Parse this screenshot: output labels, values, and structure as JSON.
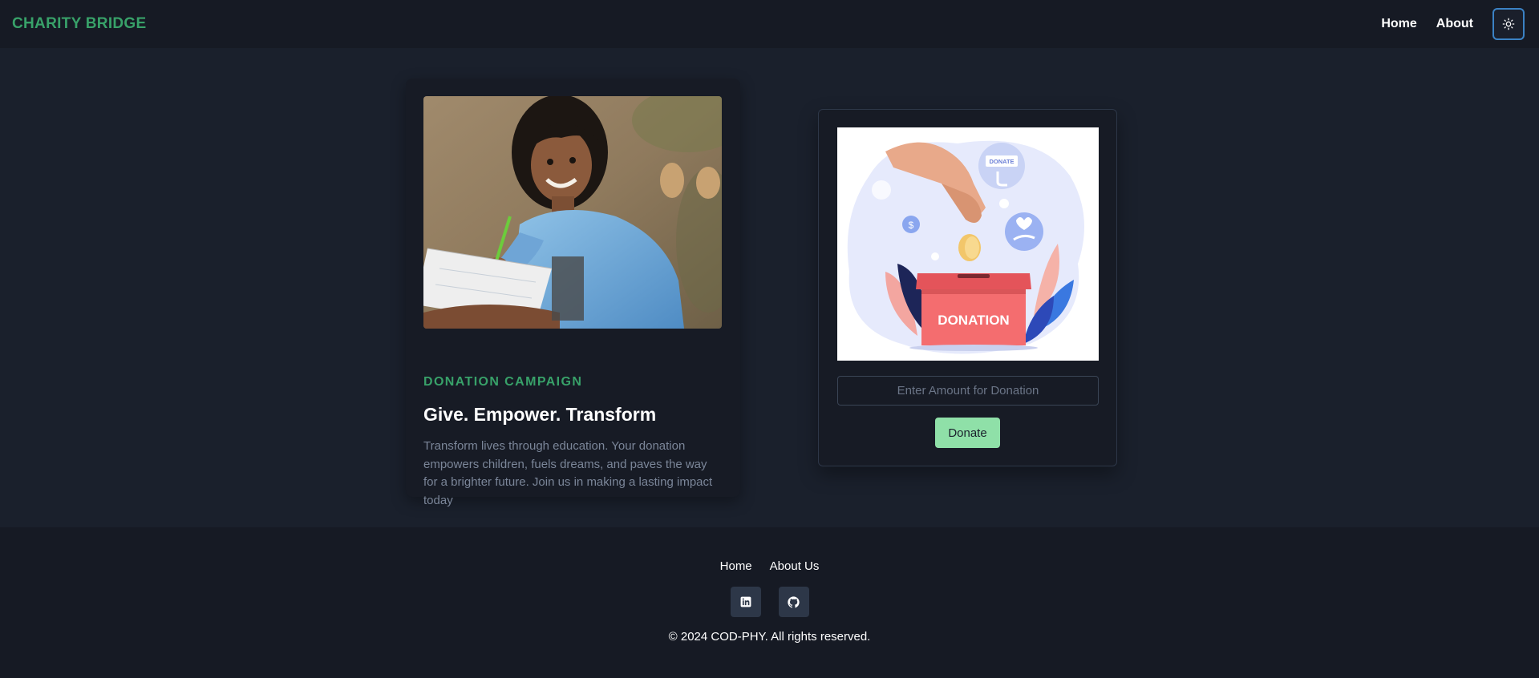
{
  "nav": {
    "brand": "CHARITY BRIDGE",
    "links": [
      "Home",
      "About"
    ],
    "theme_toggle_icon": "sun-icon"
  },
  "campaign": {
    "eyebrow": "DONATION CAMPAIGN",
    "title": "Give. Empower. Transform",
    "description": "Transform lives through education. Your donation empowers children, fuels dreams, and paves the way for a brighter future. Join us in making a lasting impact today"
  },
  "donation": {
    "illustration_label": "DONATION",
    "badge_label": "DONATE",
    "amount_placeholder": "Enter Amount for Donation",
    "button_label": "Donate"
  },
  "footer": {
    "links": [
      "Home",
      "About Us"
    ],
    "social_icons": [
      "linkedin-icon",
      "github-icon"
    ],
    "copyright": "© 2024 COD-PHY. All rights reserved."
  },
  "colors": {
    "accent_green": "#38a169",
    "button_green": "#8fe0a8",
    "page_bg": "#1a202c",
    "nav_bg": "#161a24"
  }
}
